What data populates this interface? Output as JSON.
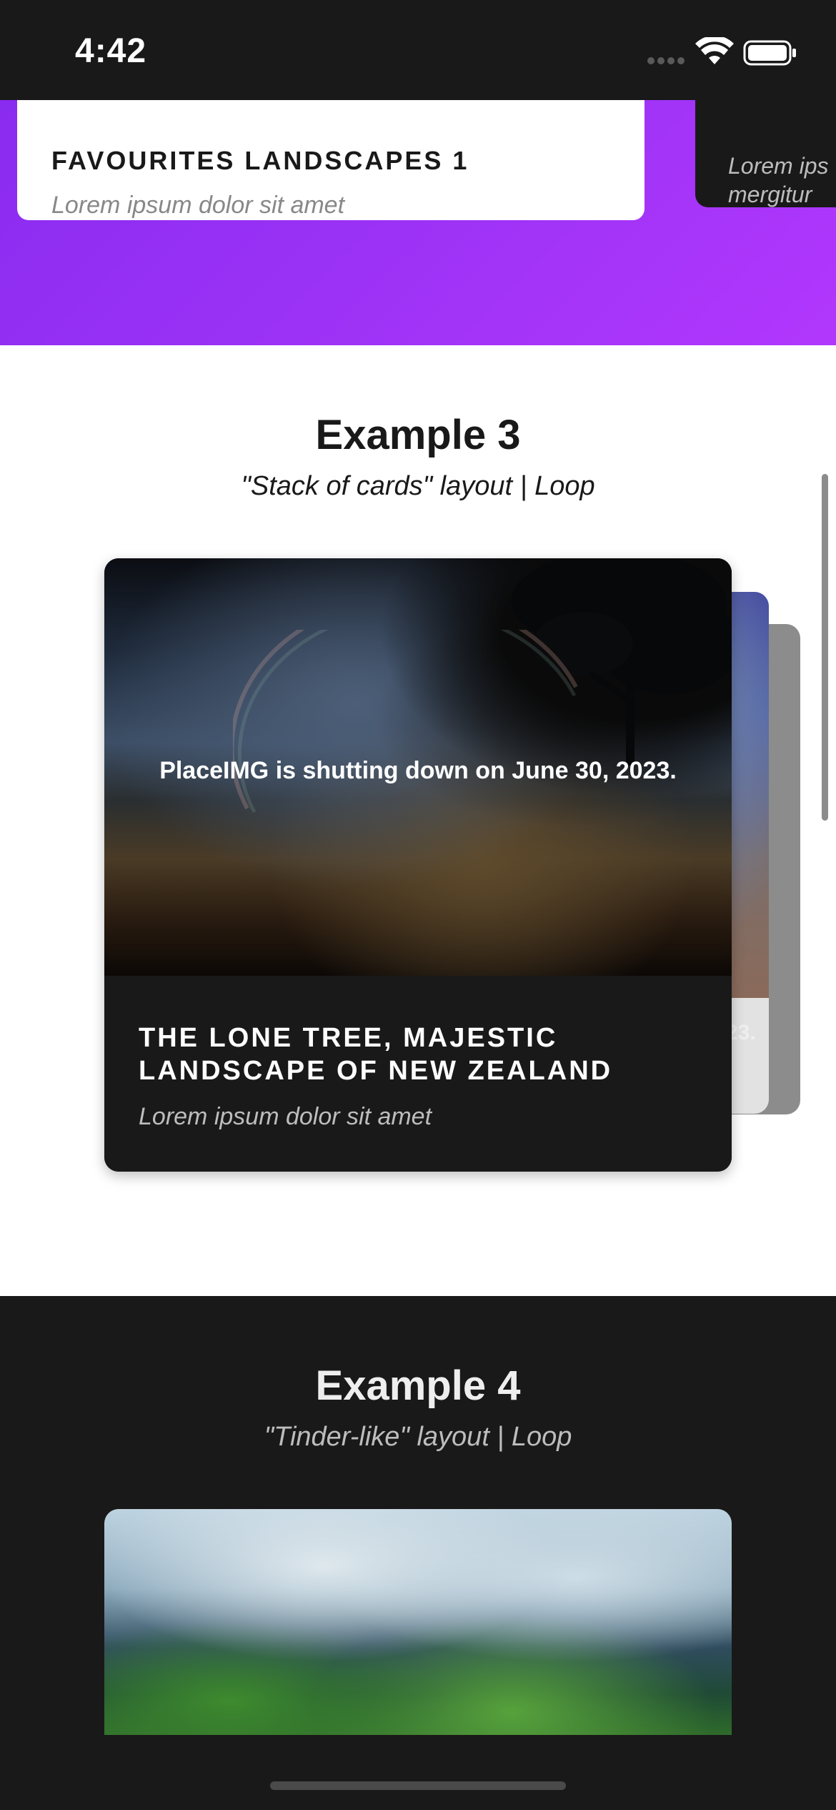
{
  "status_bar": {
    "time": "4:42"
  },
  "example2": {
    "card_white": {
      "title": "FAVOURITES LANDSCAPES 1",
      "subtitle": "Lorem ipsum dolor sit amet"
    },
    "card_dark": {
      "subtitle_line1": "Lorem ips",
      "subtitle_line2": "mergitur"
    },
    "gradient_colors": [
      "#8a2bf0",
      "#b237fd"
    ]
  },
  "example3": {
    "title": "Example 3",
    "subtitle": "\"Stack of cards\" layout | Loop",
    "front_card": {
      "image_message": "PlaceIMG is shutting down on June 30, 2023.",
      "title": "THE LONE TREE, MAJESTIC LANDSCAPE OF NEW ZEALAND",
      "subtitle": "Lorem ipsum dolor sit amet"
    },
    "back_card": {
      "image_message_fragment": "23."
    }
  },
  "example4": {
    "title": "Example 4",
    "subtitle": "\"Tinder-like\" layout | Loop"
  },
  "icons": [
    "signal-dots-icon",
    "wifi-icon",
    "battery-icon"
  ],
  "colors": {
    "dark_background": "#1a1919",
    "white_section": "#ffffff",
    "muted_text": "#888888"
  }
}
